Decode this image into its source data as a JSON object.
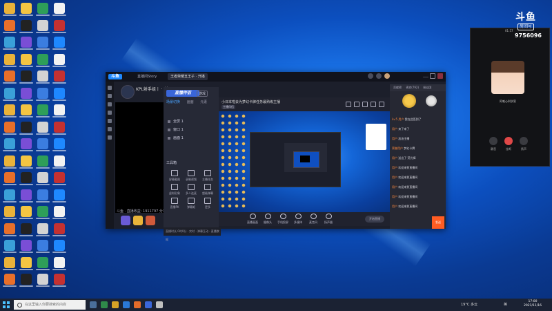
{
  "app": {
    "logo": "斗鱼",
    "tabs": [
      "直播间Story",
      "王者荣耀丑王子 · 开播"
    ],
    "stream_title": "KPL射手组丨  · 射下",
    "stats": "斗鱼 · 直播收益:  1911797   分享: 7911",
    "colors": {
      "accent": "#1e88ff",
      "send": "#ff5d23"
    }
  },
  "assistant": {
    "title": "直播伴侣",
    "badge": "游戏",
    "tabs": [
      "场景切换",
      "画面",
      "元素"
    ],
    "scenes": [
      "全屏 1",
      "窗口 1",
      "画面 1"
    ],
    "tools_label": "工具箱",
    "tools": [
      "屏幕截图",
      "录制视频",
      "主播任务",
      "虚拟形象",
      "多人连麦",
      "超级弹幕",
      "直播PK",
      "弹幕姬",
      "更多"
    ],
    "footer": "直播时长  0时0分  · 实时 · 弹幕互动 · 直播数据"
  },
  "preview": {
    "title": "小日本啦去为梦幻卡牌任务最熟练主播",
    "tag": "主播伴侣",
    "buttons": [
      "直播画面",
      "摄像头",
      "手机投屏",
      "多媒体",
      "麦克风",
      "扬声器"
    ],
    "start": "开始直播"
  },
  "chat": {
    "tabs": [
      "贡献榜",
      "贵宾(792)",
      "粉丝团"
    ],
    "messages": [
      {
        "name": "Lv.5 用户",
        "text": "我在此签到了"
      },
      {
        "name": "用户",
        "text": "来了来了"
      },
      {
        "name": "用户",
        "text": "加油主播"
      },
      {
        "name": "荣誉用户",
        "text": "梦幻卡牌"
      },
      {
        "name": "用户",
        "text": "送出了 荧光棒"
      },
      {
        "name": "用户",
        "text": "欢迎来到直播间"
      },
      {
        "name": "用户",
        "text": "欢迎来到直播间"
      },
      {
        "name": "用户",
        "text": "欢迎来到直播间"
      },
      {
        "name": "用户",
        "text": "欢迎来到直播间"
      },
      {
        "name": "用户",
        "text": "欢迎来到直播间"
      }
    ],
    "send": "发送"
  },
  "call": {
    "time": "01:57",
    "brand": "斗鱼",
    "brand_sub": "房间号",
    "room_number": "9756096",
    "name": "阿唯心科学家",
    "buttons": [
      "静音",
      "挂断",
      "扬声"
    ]
  },
  "taskbar": {
    "search_placeholder": "在这里输入你要搜索的内容",
    "tray_weather": "19°C  多云",
    "tray_lang": "英",
    "time": "17:00",
    "date": "2021/11/16"
  }
}
